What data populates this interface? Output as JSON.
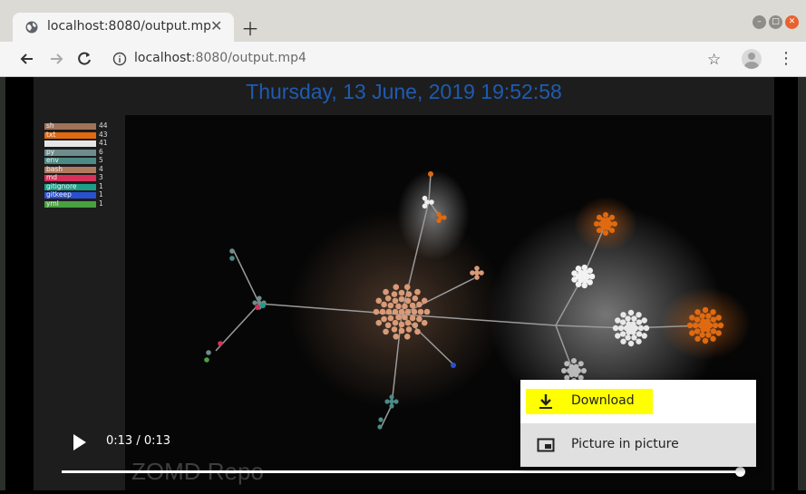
{
  "browser": {
    "tab_title": "localhost:8080/output.mp4",
    "url_host": "localhost",
    "url_path": ":8080/output.mp4"
  },
  "video": {
    "date_title": "Thursday, 13 June, 2019 19:52:58",
    "watermark": "ZOMD Repo",
    "time_display": "0:13 / 0:13",
    "progress_fraction": 1.0
  },
  "legend": [
    {
      "label": "sh",
      "count": "44",
      "color": "#a0735a"
    },
    {
      "label": "txt",
      "count": "43",
      "color": "#e06a10"
    },
    {
      "label": "",
      "count": "41",
      "color": "#e6e6e6"
    },
    {
      "label": "py",
      "count": "6",
      "color": "#6e8c8c"
    },
    {
      "label": "env",
      "count": "5",
      "color": "#4d8a86"
    },
    {
      "label": "bash",
      "count": "4",
      "color": "#b07a60"
    },
    {
      "label": "md",
      "count": "3",
      "color": "#d8305a"
    },
    {
      "label": "gitignore",
      "count": "1",
      "color": "#1a9e8a"
    },
    {
      "label": "gitkeep",
      "count": "1",
      "color": "#2850d0"
    },
    {
      "label": "yml",
      "count": "1",
      "color": "#4aa040"
    }
  ],
  "context_menu": {
    "download": "Download",
    "picture_in_picture": "Picture in picture"
  },
  "colors": {
    "title_blue": "#1f5bb0",
    "highlight_yellow": "#ffff00"
  }
}
